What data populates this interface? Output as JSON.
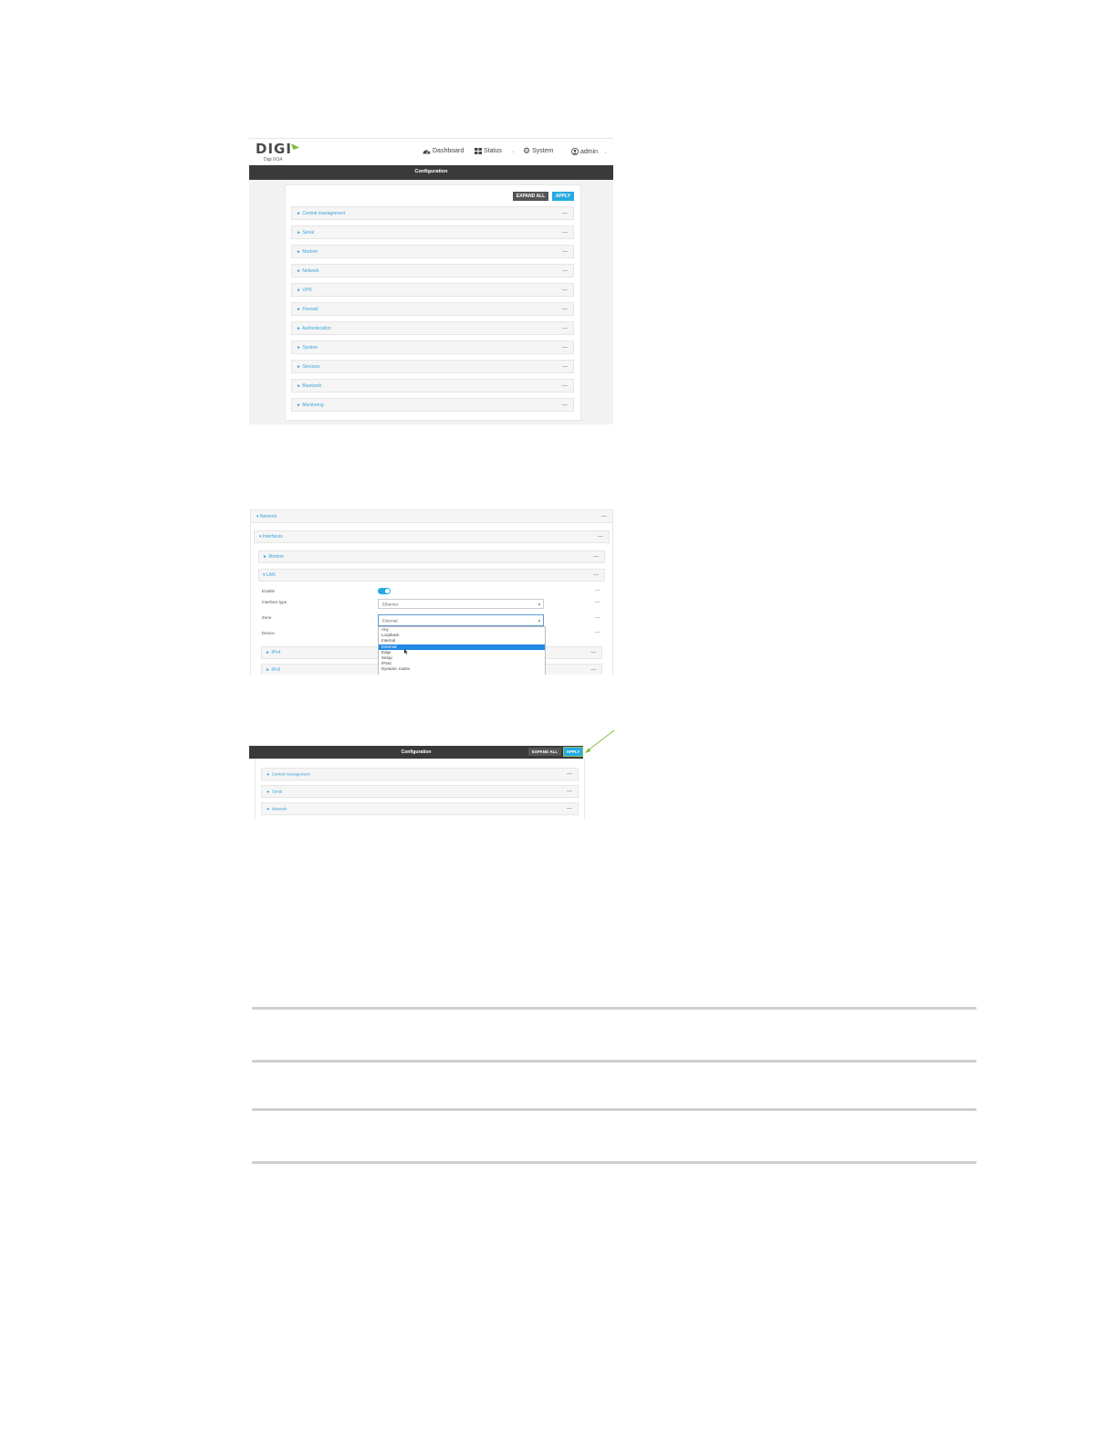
{
  "shot1": {
    "logo_text": "DIGI",
    "logo_sub": "Digi IX14",
    "nav": [
      {
        "label": "Dashboard",
        "icon": "dashboard-icon"
      },
      {
        "label": "Status",
        "icon": "grid-icon"
      },
      {
        "label": "System",
        "icon": "gear-icon"
      },
      {
        "label": "admin",
        "icon": "user-icon"
      }
    ],
    "bar_title": "Configuration",
    "expand_all": "EXPAND ALL",
    "apply": "APPLY",
    "sections": [
      "► Central management",
      "► Serial",
      "► Modem",
      "► Network",
      "► VPN",
      "► Firewall",
      "► Authentication",
      "► System",
      "► Services",
      "► Bluetooth",
      "► Monitoring"
    ],
    "dash": "—"
  },
  "shot2": {
    "network": "▾ Network",
    "interfaces": "▾ Interfaces",
    "modem": "► Modem",
    "lan": "▾ LAN",
    "enable_label": "Enable",
    "interface_type_label": "Interface type",
    "interface_type_value": "Ethernet",
    "zone_label": "Zone",
    "zone_value": "External",
    "device_label": "Device",
    "ipv4": "► IPv4",
    "ipv6": "► IPv6",
    "zone_options": [
      "Any",
      "Loopback",
      "Internal",
      "External",
      "Edge",
      "Setup",
      "IPsec",
      "Dynamic routes"
    ],
    "zone_selected_index": 3,
    "dash": "—"
  },
  "shot3": {
    "bar_title": "Configuration",
    "expand_all": "EXPAND ALL",
    "apply": "APPLY",
    "sections": [
      "► Central management",
      "► Serial",
      "► Network"
    ],
    "dash": "—"
  }
}
